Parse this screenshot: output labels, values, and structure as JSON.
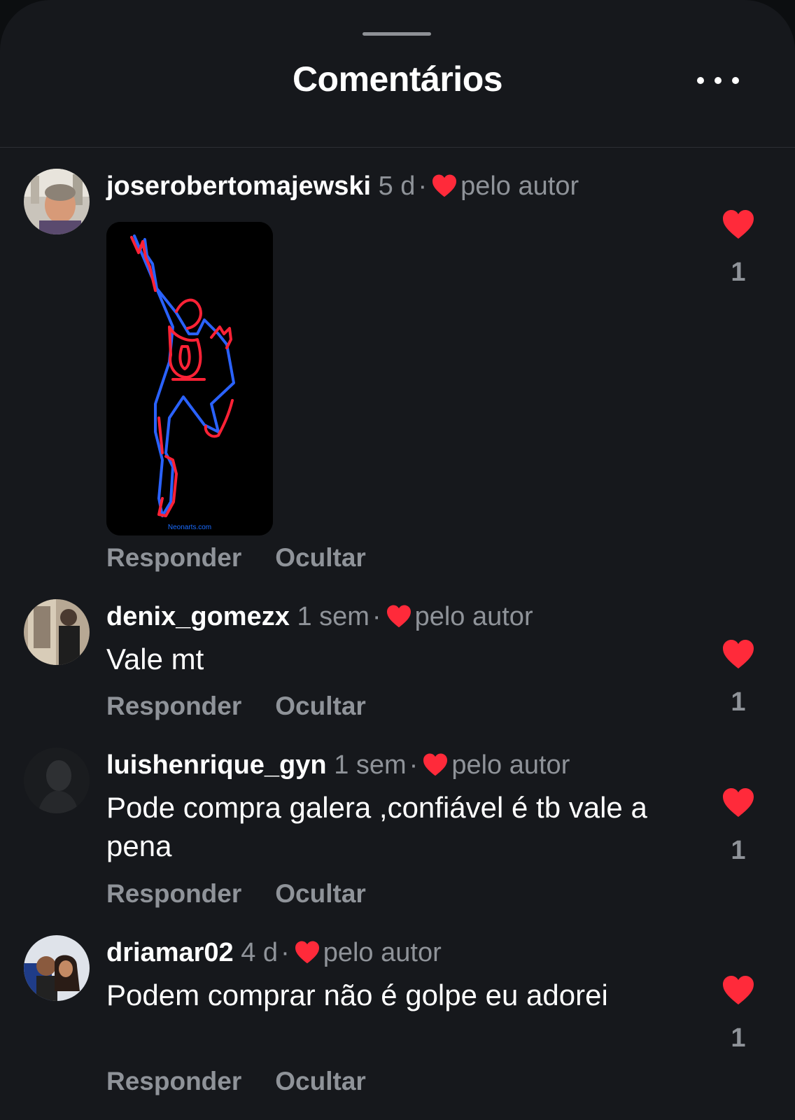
{
  "header": {
    "title": "Comentários",
    "more_icon": "more-horizontal-icon"
  },
  "colors": {
    "background": "#16181c",
    "heart": "#ff2a3a",
    "muted_text": "#8f9399"
  },
  "comments": [
    {
      "username": "joserobertomajewski",
      "time": "5 d",
      "liked_by_author_label": "pelo autor",
      "text": "",
      "media_caption": "Neonarts.com",
      "reply_label": "Responder",
      "hide_label": "Ocultar",
      "like_count": "1"
    },
    {
      "username": "denix_gomezx",
      "time": "1 sem",
      "liked_by_author_label": "pelo autor",
      "text": "Vale mt",
      "reply_label": "Responder",
      "hide_label": "Ocultar",
      "like_count": "1"
    },
    {
      "username": "luishenrique_gyn",
      "time": "1 sem",
      "liked_by_author_label": "pelo autor",
      "text": "Pode compra galera ,confiável é tb vale a pena",
      "reply_label": "Responder",
      "hide_label": "Ocultar",
      "like_count": "1"
    },
    {
      "username": "driamar02",
      "time": "4 d",
      "liked_by_author_label": "pelo autor",
      "text": "Podem comprar não é golpe eu adorei",
      "reply_label": "Responder",
      "hide_label": "Ocultar",
      "like_count": "1"
    }
  ]
}
